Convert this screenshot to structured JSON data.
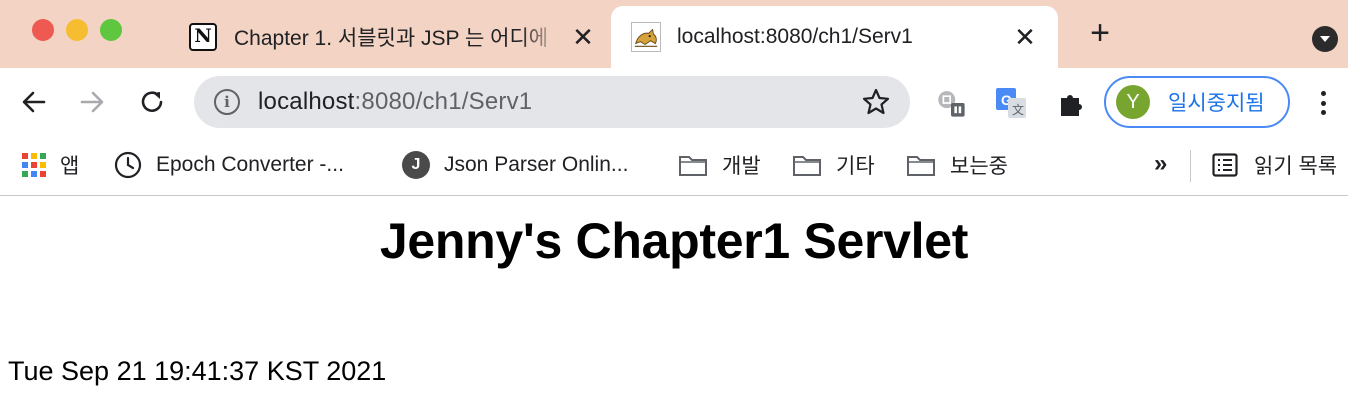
{
  "window": {
    "traffic_lights": {
      "close": "#ee5a52",
      "minimize": "#f5bd2f",
      "maximize": "#5fc63f"
    },
    "tabstrip_color": "#f3d3c3"
  },
  "tabs": [
    {
      "title": "Chapter 1. 서블릿과 JSP 는 어디에",
      "favicon": "notion-icon",
      "active": false,
      "close": "✕"
    },
    {
      "title": "localhost:8080/ch1/Serv1",
      "favicon": "tomcat-icon",
      "active": true,
      "close": "✕"
    }
  ],
  "new_tab": "+",
  "address_bar": {
    "host": "localhost",
    "rest": ":8080/ch1/Serv1"
  },
  "profile": {
    "initial": "Y",
    "label": "일시중지됨",
    "accent": "#1a73e8",
    "avatar_color": "#78a530"
  },
  "bookmarks": [
    {
      "label": "앱",
      "icon": "apps-grid-icon"
    },
    {
      "label": "Epoch Converter -...",
      "icon": "clock-icon"
    },
    {
      "label": "Json Parser Onlin...",
      "icon": "j-letter-icon"
    },
    {
      "label": "개발",
      "icon": "folder-icon"
    },
    {
      "label": "기타",
      "icon": "folder-icon"
    },
    {
      "label": "보는중",
      "icon": "folder-icon"
    }
  ],
  "bookmarks_overflow": "»",
  "reading_list": {
    "label": "읽기 목록",
    "icon": "reading-list-icon"
  },
  "page": {
    "heading": "Jenny's Chapter1 Servlet",
    "date": "Tue Sep 21 19:41:37 KST 2021"
  }
}
